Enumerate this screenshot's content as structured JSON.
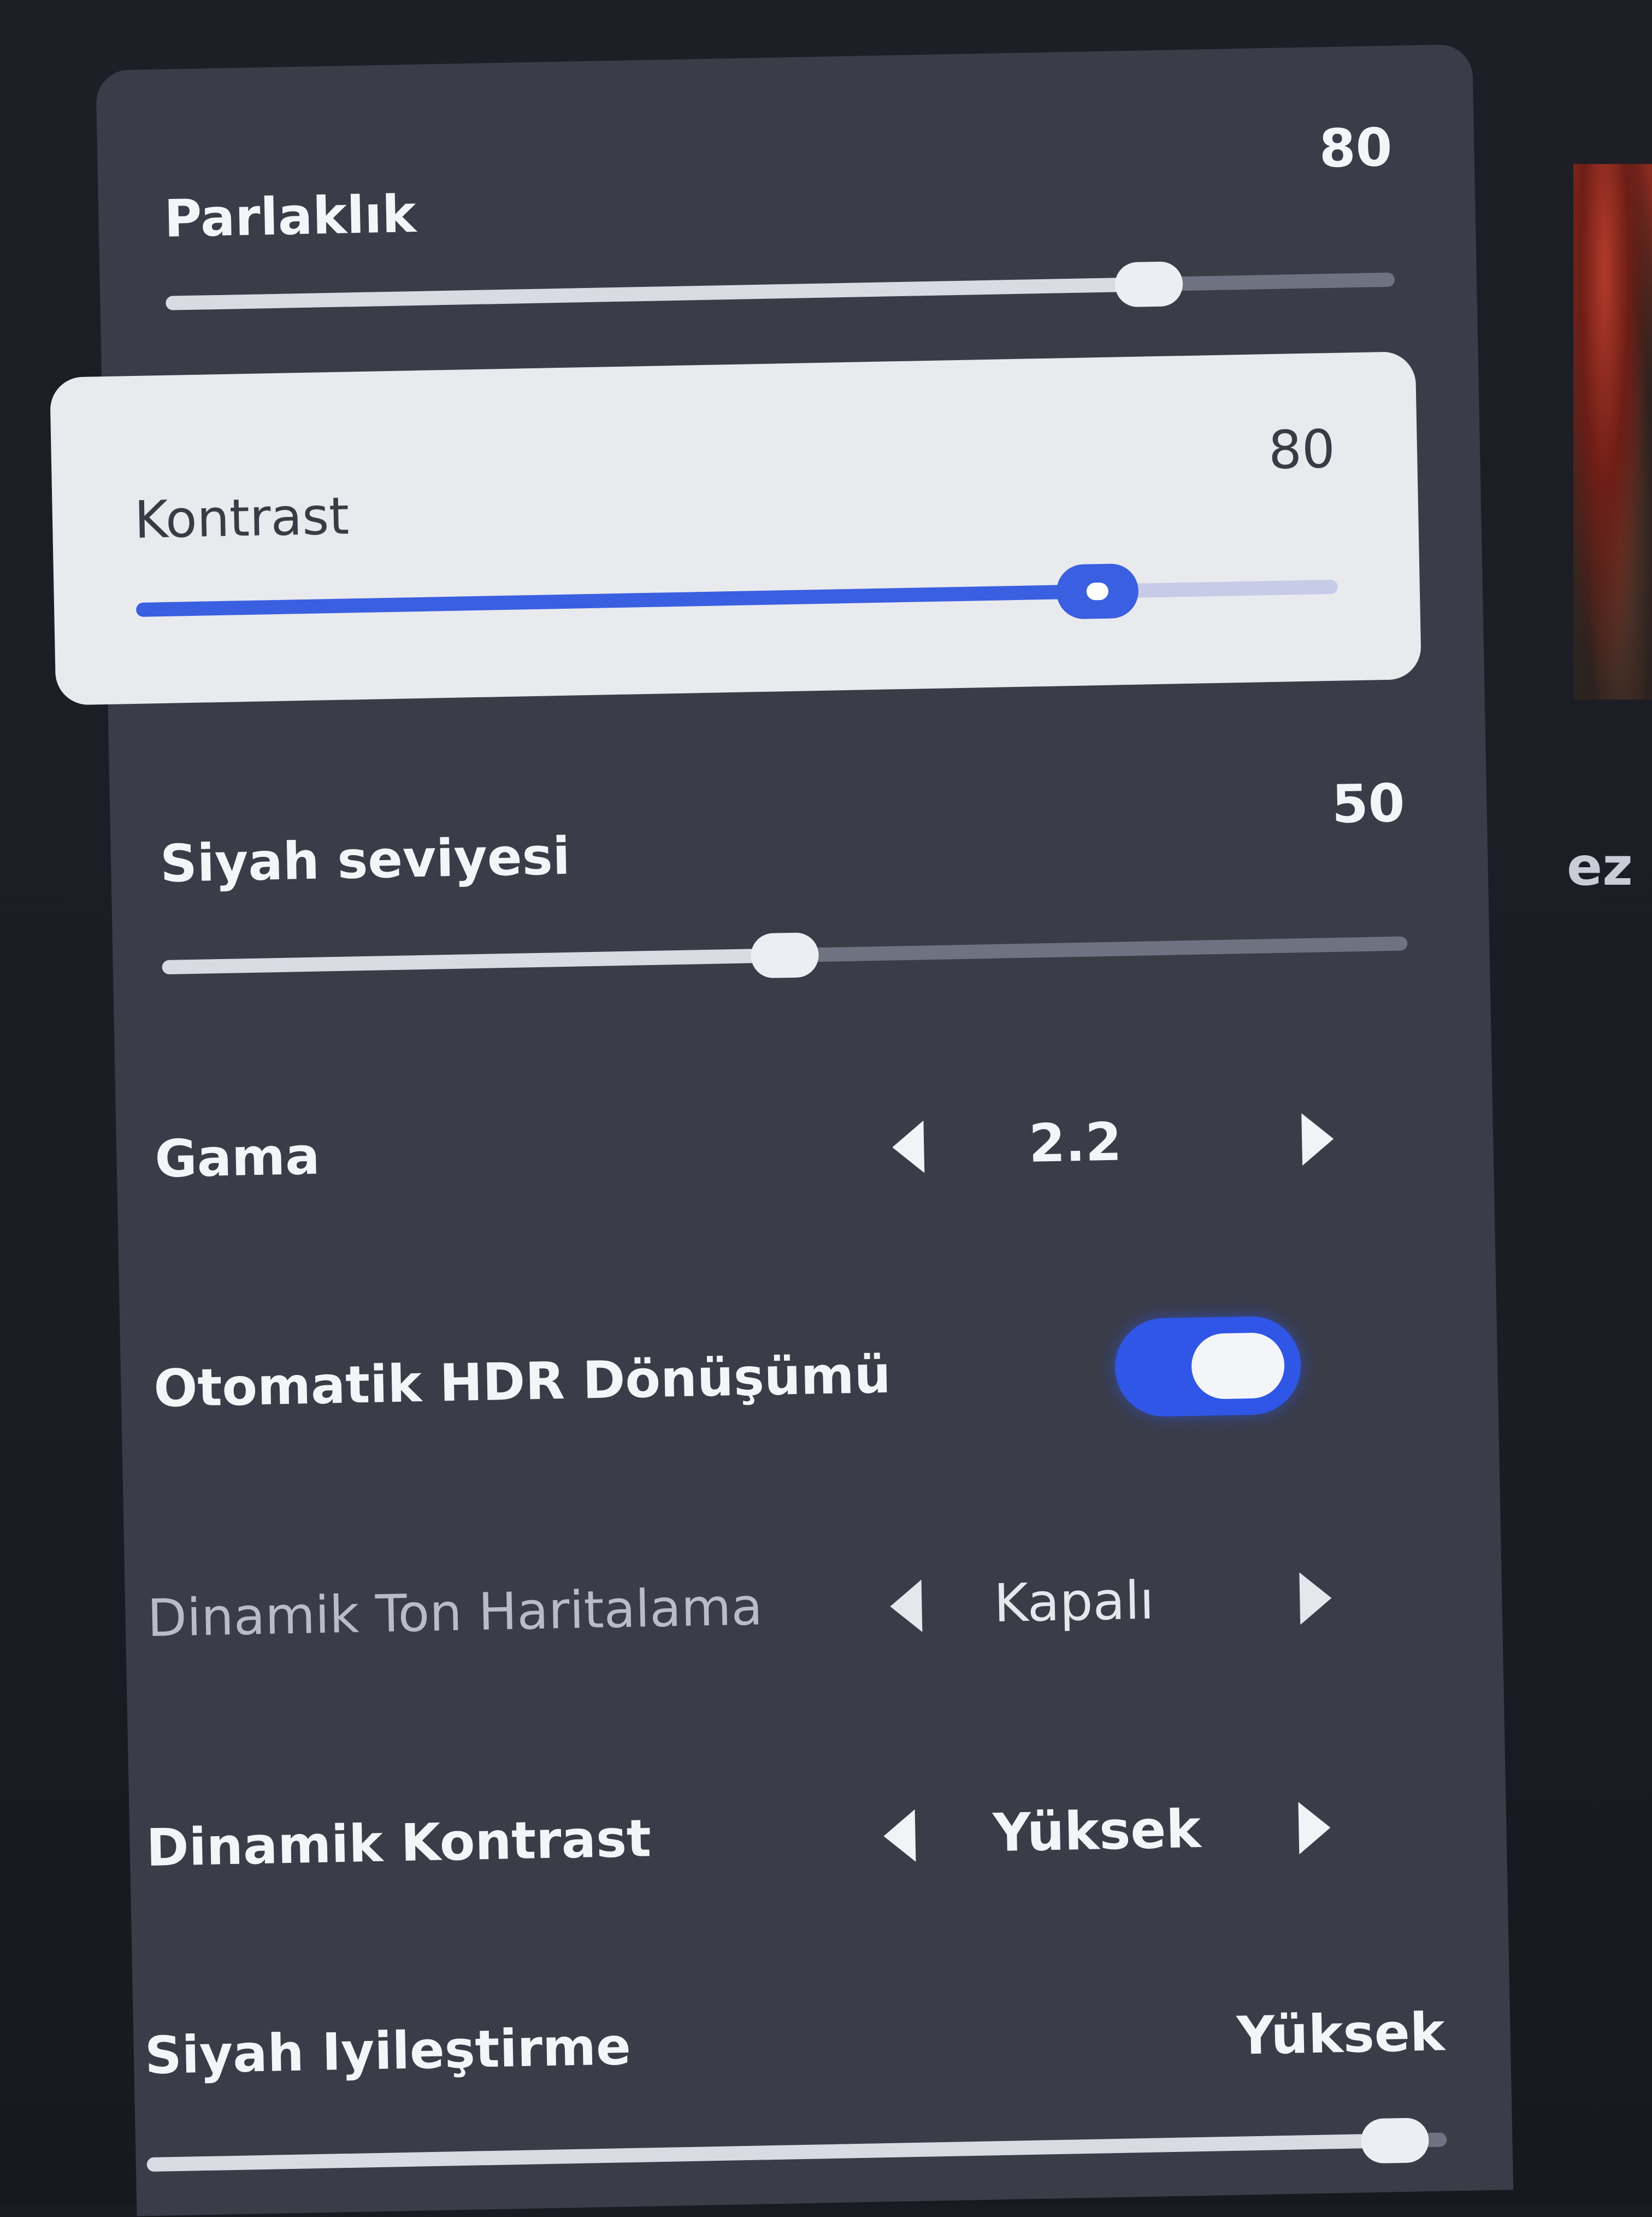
{
  "settings": {
    "brightness": {
      "label": "Parlaklık",
      "value": "80",
      "level": 0.8
    },
    "contrast": {
      "label": "Kontrast",
      "value": "80",
      "level": 0.8
    },
    "black_level": {
      "label": "Siyah seviyesi",
      "value": "50",
      "level": 0.5
    },
    "gamma": {
      "label": "Gama",
      "value": "2.2"
    },
    "auto_hdr": {
      "label": "Otomatik HDR Dönüşümü",
      "enabled": true
    },
    "dynamic_tone_mapping": {
      "label": "Dinamik Ton Haritalama",
      "value": "Kapalı",
      "disabled": true
    },
    "dynamic_contrast": {
      "label": "Dinamik Kontrast",
      "value": "Yüksek"
    },
    "black_enhancement": {
      "label": "Siyah Iyileştirme",
      "value": "Yüksek",
      "level": 1.0
    }
  },
  "background": {
    "partial_text": "ez"
  },
  "colors": {
    "accent": "#3a5fe0",
    "panel": "#3a3c48",
    "focus_card": "#e9eaee"
  },
  "icons": {
    "prev": "triangle-left-icon",
    "next": "triangle-right-icon"
  }
}
